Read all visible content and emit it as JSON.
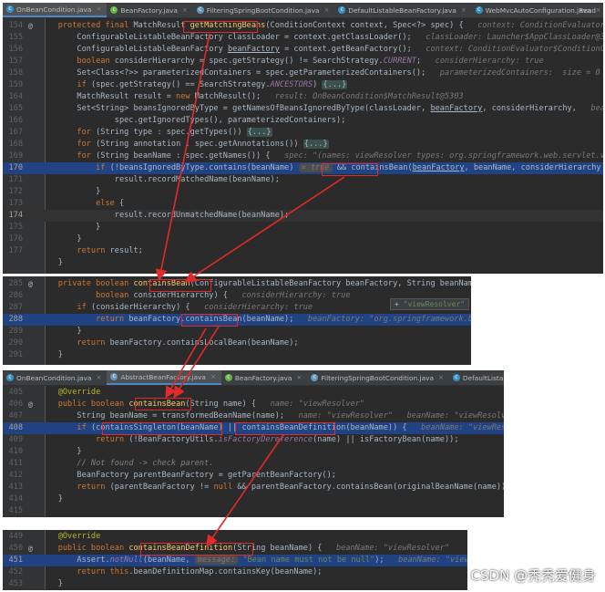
{
  "panel1": {
    "tabs": [
      {
        "label": "OnBeanCondition.java",
        "active": true,
        "icon": "class-file-icon"
      },
      {
        "label": "BeanFactory.java",
        "active": false,
        "icon": "interface-file-icon"
      },
      {
        "label": "FilteringSpringBootCondition.java",
        "active": false,
        "icon": "abstract-class-file-icon"
      },
      {
        "label": "DefaultListableBeanFactory.java",
        "active": false,
        "icon": "class-file-icon"
      },
      {
        "label": "WebMvcAutoConfiguration.java",
        "active": false,
        "icon": "class-file-icon"
      },
      {
        "label": "ContentNegotiatingVi",
        "active": false,
        "icon": "class-file-icon"
      }
    ],
    "reader_mode": "Read",
    "line_numbers": [
      "154",
      "155",
      "156",
      "157",
      "158",
      "159",
      "160",
      "161",
      "162",
      "163",
      "164",
      "165",
      "166",
      "167",
      "168",
      "169",
      "170",
      "171",
      "172",
      "173",
      "174",
      "175",
      "176",
      "177"
    ]
  },
  "panel2": {
    "line_numbers": [
      "285",
      "286",
      "287",
      "288",
      "289",
      "290",
      "291"
    ],
    "tooltip": "\"viewResolver\""
  },
  "panel3": {
    "tabs": [
      {
        "label": "OnBeanCondition.java",
        "active": false,
        "icon": "class-file-icon"
      },
      {
        "label": "AbstractBeanFactory.java",
        "active": true,
        "icon": "abstract-class-file-icon"
      },
      {
        "label": "BeanFactory.java",
        "active": false,
        "icon": "interface-file-icon"
      },
      {
        "label": "FilteringSpringBootCondition.java",
        "active": false,
        "icon": "abstract-class-file-icon"
      },
      {
        "label": "DefaultListableBeanFactory.java",
        "active": false,
        "icon": "class-file-icon"
      }
    ],
    "line_numbers": [
      "405",
      "406",
      "407",
      "408",
      "409",
      "410",
      "411",
      "412",
      "413",
      "414",
      "415"
    ]
  },
  "panel4": {
    "line_numbers": [
      "449",
      "450",
      "451",
      "452",
      "453"
    ]
  },
  "watermark": "CSDN @秃秃爱健身",
  "colors": {
    "highlight": "#214283",
    "background": "#2b2b2b",
    "annotation_box": "#e32a2a"
  }
}
